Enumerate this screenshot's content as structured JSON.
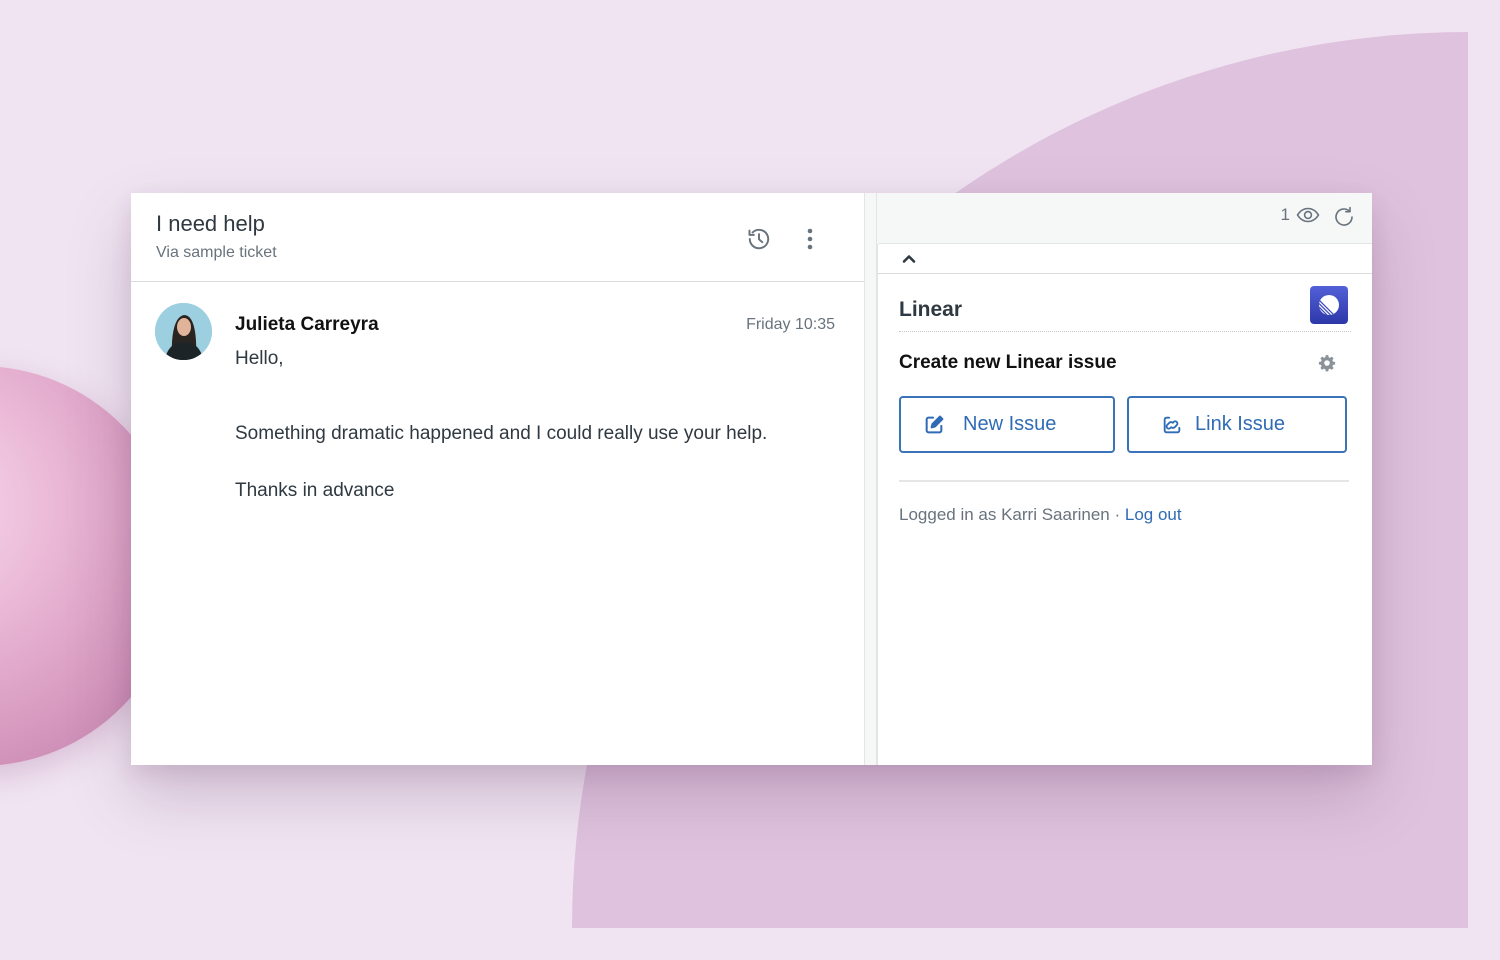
{
  "ticket": {
    "title": "I need help",
    "subtitle": "Via sample ticket",
    "icons": {
      "history": "history-icon",
      "more": "more-vertical-icon"
    }
  },
  "message": {
    "author": "Julieta Carreyra",
    "timestamp": "Friday 10:35",
    "avatar": "avatar-photo",
    "body": [
      "Hello,",
      "Something dramatic happened and I could really use your help.",
      "Thanks in advance"
    ]
  },
  "apps_panel": {
    "viewer_count": "1",
    "icons": {
      "viewers": "eye-icon",
      "refresh": "refresh-icon",
      "collapse": "chevron-up-icon"
    },
    "app": {
      "name": "Linear",
      "logo": "linear-logo-icon",
      "section_title": "Create new Linear issue",
      "settings_icon": "gear-icon",
      "buttons": {
        "new_issue": "New Issue",
        "link_issue": "Link Issue"
      },
      "login_prefix": "Logged in as Karri Saarinen · ",
      "logout_label": "Log out"
    }
  },
  "colors": {
    "background": "#f0e4f2",
    "accent_shape": "#dfc3de",
    "primary_blue": "#2f6cb5",
    "linear_brand": "#4451c8",
    "text_dark": "#2f3941",
    "text_muted": "#68737d"
  }
}
